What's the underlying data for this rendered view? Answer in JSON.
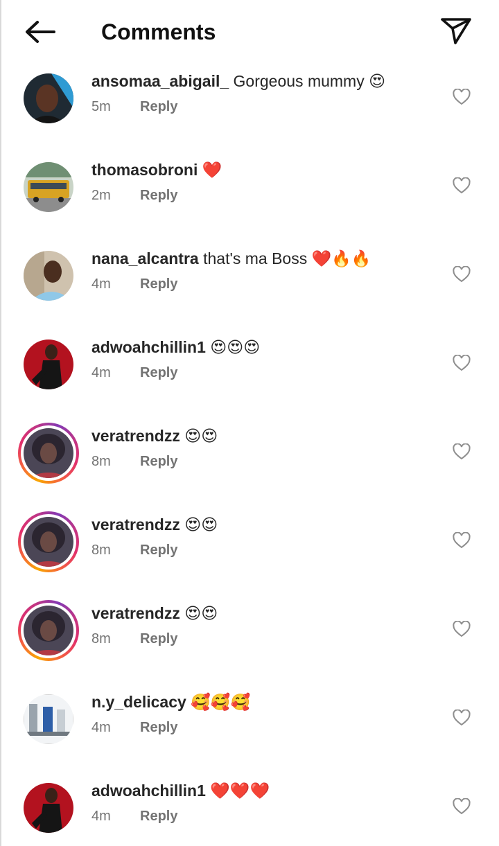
{
  "header": {
    "title": "Comments",
    "back_icon": "arrow-left-icon",
    "share_icon": "paper-plane-icon"
  },
  "colors": {
    "text": "#262626",
    "secondary": "#737373",
    "heart_outline": "#8e8e8e"
  },
  "comments": [
    {
      "username": "ansomaa_abigail_",
      "text": " Gorgeous mummy 😍",
      "time": "5m",
      "reply": "Reply"
    },
    {
      "username": "thomasobroni",
      "text": " ❤️",
      "time": "2m",
      "reply": "Reply"
    },
    {
      "username": "nana_alcantra",
      "text": " that's ma Boss ❤️🔥🔥",
      "time": "4m",
      "reply": "Reply"
    },
    {
      "username": "adwoahchillin1",
      "text": " 😍😍😍",
      "time": "4m",
      "reply": "Reply"
    },
    {
      "username": "veratrendzz",
      "text": " 😍😍",
      "time": "8m",
      "reply": "Reply"
    },
    {
      "username": "veratrendzz",
      "text": " 😍😍",
      "time": "8m",
      "reply": "Reply"
    },
    {
      "username": "veratrendzz",
      "text": " 😍😍",
      "time": "8m",
      "reply": "Reply"
    },
    {
      "username": "n.y_delicacy",
      "text": " 🥰🥰🥰",
      "time": "4m",
      "reply": "Reply"
    },
    {
      "username": "adwoahchillin1",
      "text": " ❤️❤️❤️",
      "time": "4m",
      "reply": "Reply"
    }
  ]
}
